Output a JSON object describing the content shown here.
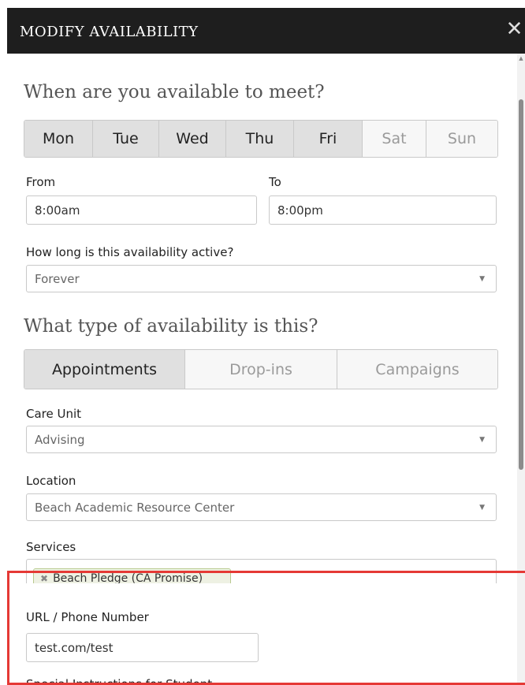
{
  "modal": {
    "title": "MODIFY AVAILABILITY",
    "close_icon": "close-icon"
  },
  "schedule": {
    "heading": "When are you available to meet?",
    "days": [
      {
        "label": "Mon",
        "selected": true
      },
      {
        "label": "Tue",
        "selected": true
      },
      {
        "label": "Wed",
        "selected": true
      },
      {
        "label": "Thu",
        "selected": true
      },
      {
        "label": "Fri",
        "selected": true
      },
      {
        "label": "Sat",
        "selected": false
      },
      {
        "label": "Sun",
        "selected": false
      }
    ],
    "from_label": "From",
    "from_value": "8:00am",
    "to_label": "To",
    "to_value": "8:00pm",
    "duration_label": "How long is this availability active?",
    "duration_value": "Forever"
  },
  "availability_type": {
    "heading": "What type of availability is this?",
    "options": [
      {
        "label": "Appointments",
        "selected": true
      },
      {
        "label": "Drop-ins",
        "selected": false
      },
      {
        "label": "Campaigns",
        "selected": false
      }
    ]
  },
  "care_unit": {
    "label": "Care Unit",
    "value": "Advising"
  },
  "location": {
    "label": "Location",
    "value": "Beach Academic Resource Center"
  },
  "services": {
    "label": "Services",
    "tags": [
      "Beach Pledge (CA Promise)"
    ]
  },
  "contact": {
    "label": "URL / Phone Number",
    "value": "test.com/test"
  },
  "instructions": {
    "label": "Special Instructions for Student"
  },
  "colors": {
    "header_bg": "#1e1e1e",
    "selected_segment": "#e0e0e0",
    "highlight_border": "#e53935"
  }
}
